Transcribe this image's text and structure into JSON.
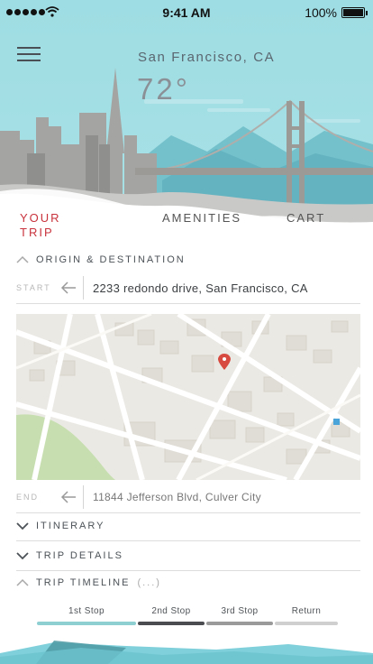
{
  "status_bar": {
    "time": "9:41 AM",
    "battery_percent": "100%",
    "battery_level": 1.0,
    "signal_bars": 5
  },
  "hero": {
    "city": "San Francisco, CA",
    "temperature": "72°"
  },
  "tabs": [
    {
      "label": "YOUR TRIP",
      "active": true
    },
    {
      "label": "AMENITIES",
      "active": false
    },
    {
      "label": "CART",
      "active": false
    }
  ],
  "origin_destination": {
    "title": "ORIGIN & DESTINATION",
    "start_label": "START",
    "start_value": "2233 redondo drive, San Francisco, CA",
    "end_label": "END",
    "end_value": "11844 Jefferson Blvd, Culver City"
  },
  "sections": {
    "itinerary": "ITINERARY",
    "trip_details": "TRIP DETAILS",
    "trip_timeline": "TRIP TIMELINE",
    "trip_timeline_suffix": "(...)"
  },
  "timeline": [
    {
      "label": "1st Stop",
      "color": "#8ecfd2"
    },
    {
      "label": "2nd Stop",
      "color": "#4a4c50"
    },
    {
      "label": "3rd Stop",
      "color": "#9a9a9a"
    },
    {
      "label": "Return",
      "color": "#cfcfcf"
    }
  ],
  "colors": {
    "accent": "#c8323c",
    "sky": "#9fdbe1",
    "text": "#4c5257"
  },
  "icons": {
    "menu": "hamburger-icon",
    "back": "arrow-left-icon",
    "pin": "map-pin-icon",
    "chevron_up": "chevron-up-icon",
    "chevron_down": "chevron-down-icon"
  }
}
